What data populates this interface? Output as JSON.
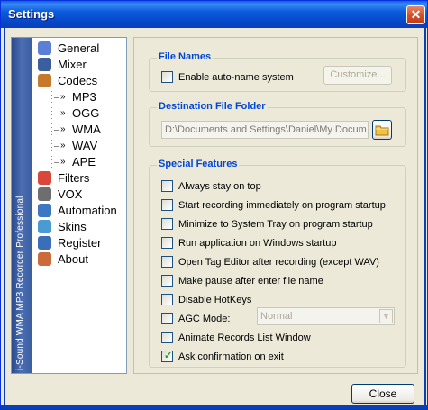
{
  "window": {
    "title": "Settings"
  },
  "titlebar": {
    "close_glyph": "✕"
  },
  "sidebar": {
    "brand": "i-Sound WMA MP3 Recorder Professional",
    "items": [
      {
        "label": "General",
        "icon": "gear-icon",
        "color": "#5b7fd6"
      },
      {
        "label": "Mixer",
        "icon": "info-icon",
        "color": "#3a5e9e"
      },
      {
        "label": "Codecs",
        "icon": "codecs-icon",
        "color": "#c47a2a"
      },
      {
        "label": "MP3",
        "icon": "arrow-icon"
      },
      {
        "label": "OGG",
        "icon": "arrow-icon"
      },
      {
        "label": "WMA",
        "icon": "arrow-icon"
      },
      {
        "label": "WAV",
        "icon": "arrow-icon"
      },
      {
        "label": "APE",
        "icon": "arrow-icon"
      },
      {
        "label": "Filters",
        "icon": "filters-icon",
        "color": "#d9463a"
      },
      {
        "label": "VOX",
        "icon": "vox-icon",
        "color": "#6e6e6e"
      },
      {
        "label": "Automation",
        "icon": "automation-icon",
        "color": "#3d77c4"
      },
      {
        "label": "Skins",
        "icon": "skins-icon",
        "color": "#4a9ad3"
      },
      {
        "label": "Register",
        "icon": "register-icon",
        "color": "#3a6fb8"
      },
      {
        "label": "About",
        "icon": "about-icon",
        "color": "#cc6a3a"
      }
    ]
  },
  "file_names": {
    "title": "File Names",
    "auto_name_label": "Enable auto-name system",
    "auto_name_checked": false,
    "customize_label": "Customize..."
  },
  "destination": {
    "title": "Destination File Folder",
    "path": "D:\\Documents and Settings\\Daniel\\My Docum",
    "folder_icon": "folder-icon"
  },
  "special": {
    "title": "Special  Features",
    "options": [
      {
        "label": "Always stay on top",
        "checked": false
      },
      {
        "label": "Start recording immediately on program startup",
        "checked": false
      },
      {
        "label": "Minimize to System Tray on program startup",
        "checked": false
      },
      {
        "label": "Run application on Windows startup",
        "checked": false
      },
      {
        "label": "Open Tag Editor after recording (except WAV)",
        "checked": false
      },
      {
        "label": "Make pause after enter file name",
        "checked": false
      },
      {
        "label": "Disable HotKeys",
        "checked": false
      },
      {
        "label": "AGC Mode:",
        "checked": false
      },
      {
        "label": "Animate Records List Window",
        "checked": false
      },
      {
        "label": "Ask confirmation on exit",
        "checked": true
      }
    ],
    "agc_value": "Normal"
  },
  "footer": {
    "close_label": "Close"
  }
}
